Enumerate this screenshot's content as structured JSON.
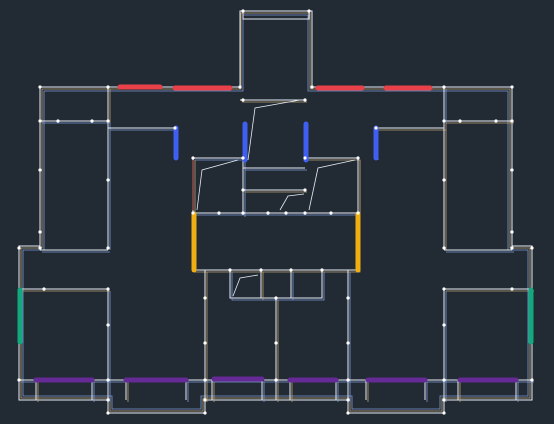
{
  "drawing": {
    "background": "#222a33",
    "line_colors": {
      "wall_outline": "#e8ecf4",
      "wall_center": "#b9a070",
      "wall_inner": "#7e9bd8",
      "node": "#ffffff"
    },
    "element_legend": {
      "window_top": "#e8414a",
      "window_mid": "#3f5ff0",
      "window_court": "#f0ae12",
      "window_side": "#13a97e",
      "window_bottom": "#652a95"
    }
  }
}
